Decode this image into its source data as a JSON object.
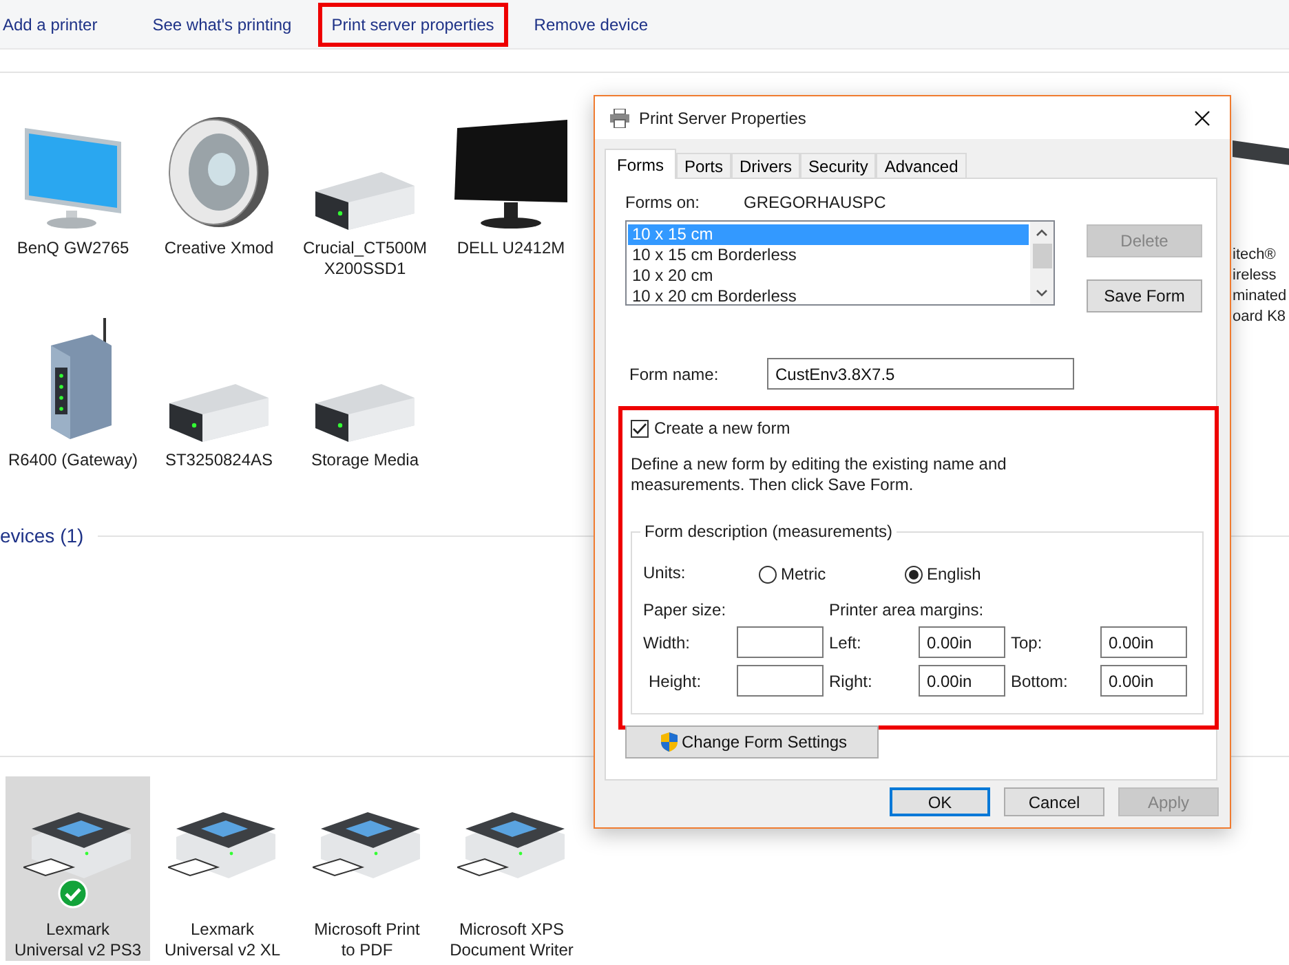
{
  "toolbar": {
    "items": [
      {
        "label": "Add a printer",
        "highlighted": false
      },
      {
        "label": "See what's printing",
        "highlighted": false
      },
      {
        "label": "Print server properties",
        "highlighted": true
      },
      {
        "label": "Remove device",
        "highlighted": false
      }
    ]
  },
  "devices": [
    {
      "kind": "monitor",
      "lines": [
        "BenQ GW2765"
      ]
    },
    {
      "kind": "speaker",
      "lines": [
        "Creative Xmod"
      ]
    },
    {
      "kind": "drive",
      "lines": [
        "Crucial_CT500M",
        "X200SSD1"
      ]
    },
    {
      "kind": "dark-monitor",
      "lines": [
        "DELL U2412M"
      ]
    },
    {
      "kind": "router",
      "lines": [
        "R6400 (Gateway)"
      ]
    },
    {
      "kind": "drive",
      "lines": [
        "ST3250824AS"
      ]
    },
    {
      "kind": "drive",
      "lines": [
        "Storage Media"
      ]
    }
  ],
  "partial_device": {
    "kind": "keyboard",
    "lines": [
      "itech®",
      "ireless",
      "minated",
      "oard K8"
    ]
  },
  "printers_section": {
    "title": "evices (1)"
  },
  "printers": [
    {
      "lines": [
        "Lexmark",
        "Universal v2 PS3"
      ],
      "selected": true,
      "default": true
    },
    {
      "lines": [
        "Lexmark",
        "Universal v2 XL"
      ],
      "selected": false,
      "default": false
    },
    {
      "lines": [
        "Microsoft Print",
        "to PDF"
      ],
      "selected": false,
      "default": false
    },
    {
      "lines": [
        "Microsoft XPS",
        "Document Writer"
      ],
      "selected": false,
      "default": false
    }
  ],
  "dialog": {
    "title": "Print Server Properties",
    "tabs": [
      {
        "label": "Forms",
        "selected": true
      },
      {
        "label": "Ports",
        "selected": false
      },
      {
        "label": "Drivers",
        "selected": false
      },
      {
        "label": "Security",
        "selected": false
      },
      {
        "label": "Advanced",
        "selected": false
      }
    ],
    "forms_on_label": "Forms on:",
    "server_name": "GREGORHAUSPC",
    "forms_list": [
      {
        "label": "10 x 15 cm",
        "selected": true
      },
      {
        "label": "10 x 15 cm Borderless",
        "selected": false
      },
      {
        "label": "10 x 20 cm",
        "selected": false
      },
      {
        "label": "10 x 20 cm Borderless",
        "selected": false
      }
    ],
    "side_buttons": [
      {
        "label": "Delete",
        "disabled": true
      },
      {
        "label": "Save Form",
        "disabled": false
      }
    ],
    "form_name": {
      "label": "Form name:",
      "value": "CustEnv3.8X7.5"
    },
    "create_section": {
      "highlighted": true,
      "checkbox": {
        "label": "Create a new form",
        "checked": true
      },
      "description": "Define a new form by editing the existing name and measurements. Then click Save Form."
    },
    "measurements": {
      "title": "Form description (measurements)",
      "units_label": "Units:",
      "units": [
        {
          "label": "Metric",
          "selected": false
        },
        {
          "label": "English",
          "selected": true
        }
      ],
      "paper_size_label": "Paper size:",
      "margins_label": "Printer area margins:",
      "rows": [
        {
          "label": "Width:",
          "margins": [
            {
              "label": "Left:",
              "value": "0.00in"
            },
            {
              "label": "Top:",
              "value": "0.00in"
            }
          ]
        },
        {
          "label": "Height:",
          "margins": [
            {
              "label": "Right:",
              "value": "0.00in"
            },
            {
              "label": "Bottom:",
              "value": "0.00in"
            }
          ]
        }
      ]
    },
    "change_settings_button": "Change Form Settings",
    "buttons": [
      {
        "label": "OK",
        "default": true,
        "disabled": false
      },
      {
        "label": "Cancel",
        "default": false,
        "disabled": false
      },
      {
        "label": "Apply",
        "default": false,
        "disabled": true
      }
    ]
  }
}
